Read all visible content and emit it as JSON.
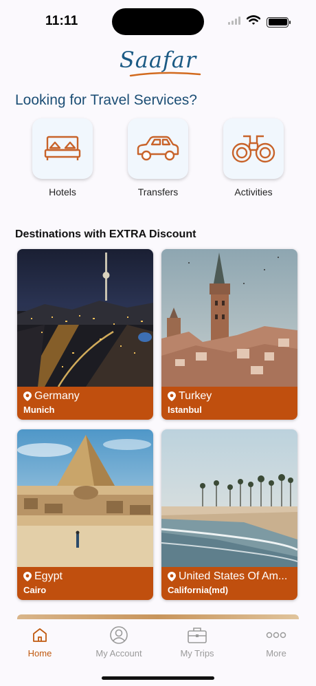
{
  "status_bar": {
    "time": "11:11"
  },
  "brand": {
    "logo_text": "Saafar",
    "logo_color": "#1b5a84",
    "accent": "#c04f0e"
  },
  "services": {
    "heading": "Looking for Travel Services?",
    "items": [
      {
        "label": "Hotels",
        "icon": "bed-icon"
      },
      {
        "label": "Transfers",
        "icon": "car-icon"
      },
      {
        "label": "Activities",
        "icon": "binoculars-icon"
      }
    ]
  },
  "destinations": {
    "heading": "Destinations with EXTRA Discount",
    "items": [
      {
        "country": "Germany",
        "city": "Munich",
        "image": "night-city-skyline-with-tv-tower"
      },
      {
        "country": "Turkey",
        "city": "Istanbul",
        "image": "galata-tower-old-city"
      },
      {
        "country": "Egypt",
        "city": "Cairo",
        "image": "pyramid-and-sphinx-desert"
      },
      {
        "country": "United States Of Am...",
        "city": "California(md)",
        "image": "palm-beach-coastline"
      }
    ]
  },
  "tabbar": {
    "tabs": [
      {
        "label": "Home",
        "icon": "home-icon",
        "active": true
      },
      {
        "label": "My Account",
        "icon": "account-icon",
        "active": false
      },
      {
        "label": "My Trips",
        "icon": "briefcase-icon",
        "active": false
      },
      {
        "label": "More",
        "icon": "more-icon",
        "active": false
      }
    ]
  }
}
